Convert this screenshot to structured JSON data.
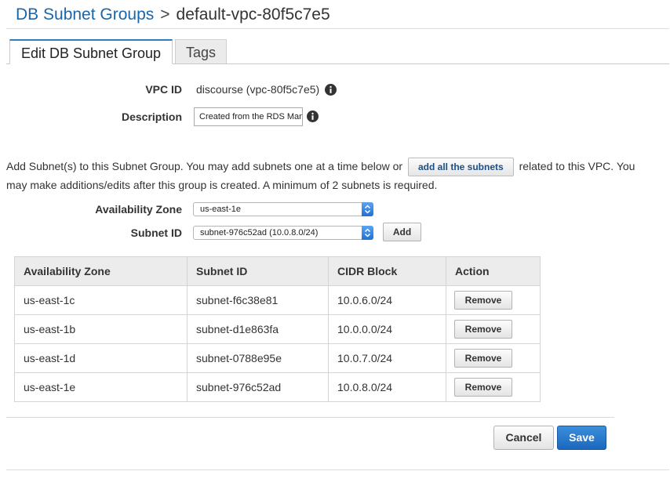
{
  "breadcrumb": {
    "parent": "DB Subnet Groups",
    "separator": ">",
    "current": "default-vpc-80f5c7e5"
  },
  "tabs": [
    {
      "label": "Edit DB Subnet Group",
      "active": true
    },
    {
      "label": "Tags",
      "active": false
    }
  ],
  "form": {
    "vpc_id_label": "VPC ID",
    "vpc_id_value": "discourse (vpc-80f5c7e5)",
    "description_label": "Description",
    "description_value": "Created from the RDS Management Console"
  },
  "subnets_intro": {
    "text_before": "Add Subnet(s) to this Subnet Group. You may add subnets one at a time below or",
    "add_all_label": "add all the subnets",
    "text_after": "related to this VPC. You may make additions/edits after this group is created. A minimum of 2 subnets is required."
  },
  "selectors": {
    "availability_zone_label": "Availability Zone",
    "availability_zone_value": "us-east-1e",
    "subnet_id_label": "Subnet ID",
    "subnet_id_value": "subnet-976c52ad (10.0.8.0/24)",
    "add_label": "Add"
  },
  "table": {
    "headers": [
      "Availability Zone",
      "Subnet ID",
      "CIDR Block",
      "Action"
    ],
    "rows": [
      {
        "zone": "us-east-1c",
        "subnet": "subnet-f6c38e81",
        "cidr": "10.0.6.0/24",
        "action": "Remove"
      },
      {
        "zone": "us-east-1b",
        "subnet": "subnet-d1e863fa",
        "cidr": "10.0.0.0/24",
        "action": "Remove"
      },
      {
        "zone": "us-east-1d",
        "subnet": "subnet-0788e95e",
        "cidr": "10.0.7.0/24",
        "action": "Remove"
      },
      {
        "zone": "us-east-1e",
        "subnet": "subnet-976c52ad",
        "cidr": "10.0.8.0/24",
        "action": "Remove"
      }
    ]
  },
  "footer": {
    "cancel_label": "Cancel",
    "save_label": "Save"
  },
  "colors": {
    "link": "#1b66a8",
    "primary_button": "#2a7bd0",
    "tab_accent": "#2d7fc3"
  }
}
